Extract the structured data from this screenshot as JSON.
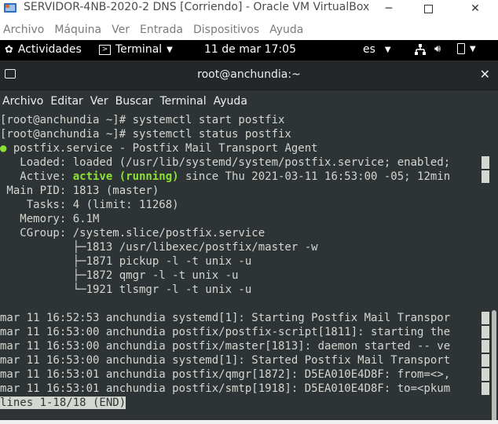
{
  "vbox": {
    "title": "SERVIDOR-4NB-2020-2 DNS [Corriendo] - Oracle VM VirtualBox",
    "menu": [
      "Archivo",
      "Máquina",
      "Ver",
      "Entrada",
      "Dispositivos",
      "Ayuda"
    ]
  },
  "gnome": {
    "activities": "Actividades",
    "app": "Terminal",
    "clock": "11 de mar  17:05",
    "lang": "es"
  },
  "terminal": {
    "title": "root@anchundia:~",
    "menu": [
      "Archivo",
      "Editar",
      "Ver",
      "Buscar",
      "Terminal",
      "Ayuda"
    ],
    "lines": [
      "[root@anchundia ~]# systemctl start postfix",
      "[root@anchundia ~]# systemctl status postfix",
      "postfix.service - Postfix Mail Transport Agent",
      "   Loaded: loaded (/usr/lib/systemd/system/postfix.service; enabled;",
      "   Active: ",
      "active (running)",
      " since Thu 2021-03-11 16:53:00 -05; 12min",
      " Main PID: 1813 (master)",
      "    Tasks: 4 (limit: 11268)",
      "   Memory: 6.1M",
      "   CGroup: /system.slice/postfix.service",
      "           ├─1813 /usr/libexec/postfix/master -w",
      "           ├─1871 pickup -l -t unix -u",
      "           ├─1872 qmgr -l -t unix -u",
      "           └─1921 tlsmgr -l -t unix -u",
      "mar 11 16:52:53 anchundia systemd[1]: Starting Postfix Mail Transpor",
      "mar 11 16:53:00 anchundia postfix/postfix-script[1811]: starting the",
      "mar 11 16:53:00 anchundia postfix/master[1813]: daemon started -- ve",
      "mar 11 16:53:00 anchundia systemd[1]: Started Postfix Mail Transport",
      "mar 11 16:53:01 anchundia postfix/qmgr[1872]: D5EA010E4D8F: from=<>,",
      "mar 11 16:53:01 anchundia postfix/smtp[1918]: D5EA010E4D8F: to=<pkum",
      "lines 1-18/18 (END)"
    ]
  },
  "colors": {
    "terminal_bg": "#2e3436",
    "terminal_fg": "#d3d7cf",
    "active_green": "#8ae234"
  }
}
